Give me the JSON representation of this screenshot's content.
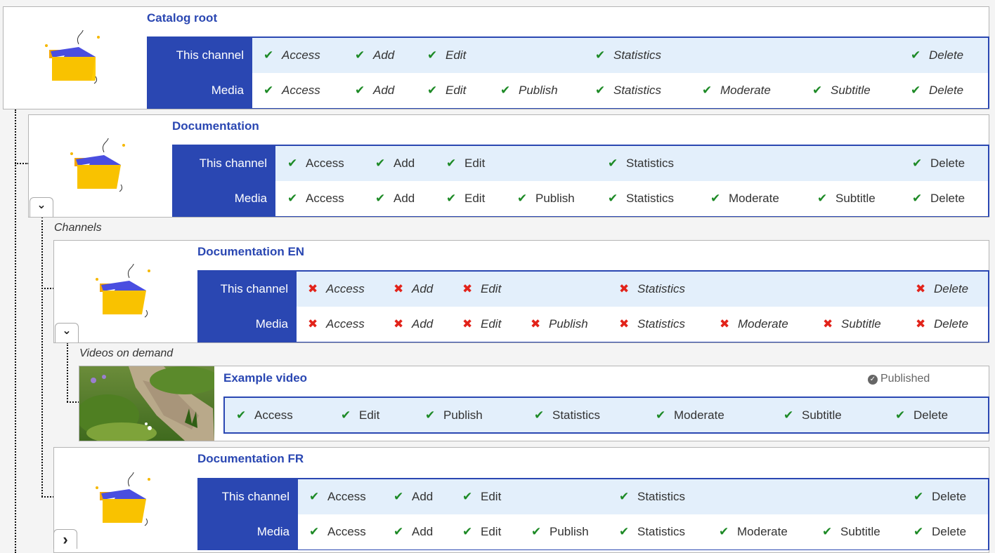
{
  "icons": {
    "allowed": "check-icon",
    "denied": "cross-icon",
    "expand": "chevron-down-icon",
    "collapse": "chevron-right-icon",
    "status": "check-circle-icon"
  },
  "colors": {
    "brand_blue": "#2a47b2",
    "allowed": "#1d8a26",
    "denied": "#e2231a",
    "row_tint": "#e3effb"
  },
  "labels": {
    "this_channel": "This channel",
    "media": "Media"
  },
  "perm_labels": {
    "access": "Access",
    "add": "Add",
    "edit": "Edit",
    "publish": "Publish",
    "statistics": "Statistics",
    "moderate": "Moderate",
    "subtitle": "Subtitle",
    "delete": "Delete"
  },
  "catalog_root": {
    "title": "Catalog root"
  },
  "documentation": {
    "title": "Documentation",
    "channels_label": "Channels"
  },
  "doc_en": {
    "title": "Documentation EN",
    "videos_label": "Videos on demand"
  },
  "example_video": {
    "title": "Example video",
    "status": "Published"
  },
  "doc_fr": {
    "title": "Documentation FR"
  },
  "glyphs": {
    "check": "✔",
    "cross": "✖",
    "chev_down": "⌄",
    "chev_right": "›",
    "status_check": "✓"
  }
}
